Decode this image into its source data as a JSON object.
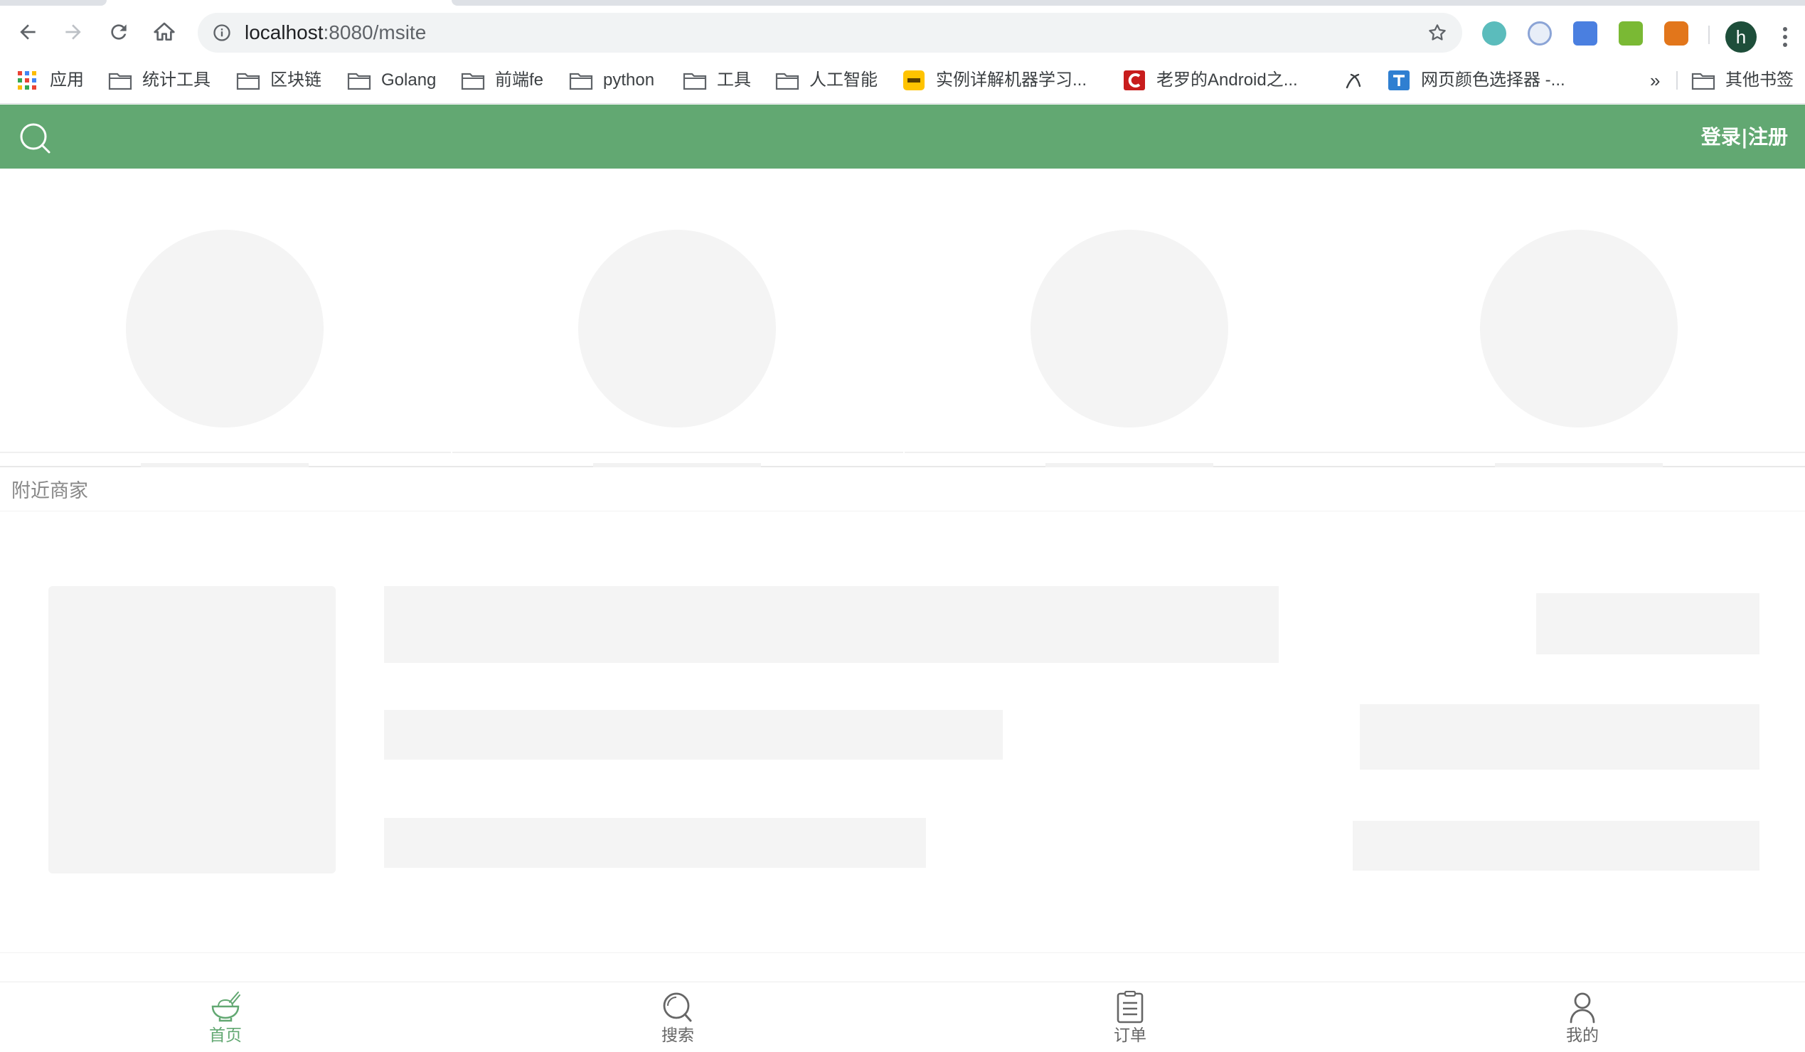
{
  "browser": {
    "url_host": "localhost",
    "url_path": ":8080/msite",
    "profile_initial": "h",
    "bookmarks": [
      {
        "label": "应用",
        "icon": "apps-grid-icon"
      },
      {
        "label": "统计工具",
        "icon": "folder-icon"
      },
      {
        "label": "区块链",
        "icon": "folder-icon"
      },
      {
        "label": "Golang",
        "icon": "folder-icon"
      },
      {
        "label": "前端fe",
        "icon": "folder-icon"
      },
      {
        "label": "python",
        "icon": "folder-icon"
      },
      {
        "label": "工具",
        "icon": "folder-icon"
      },
      {
        "label": "人工智能",
        "icon": "folder-icon"
      },
      {
        "label": "实例详解机器学习...",
        "icon": "meituan-favicon"
      },
      {
        "label": "老罗的Android之...",
        "icon": "csdn-favicon"
      },
      {
        "label": "",
        "icon": "custom-favicon"
      },
      {
        "label": "网页颜色选择器 -...",
        "icon": "site-favicon"
      }
    ],
    "more_bookmarks": "»",
    "other_bookmarks": "其他书签"
  },
  "app": {
    "header": {
      "login_text": "登录|注册",
      "bg_color": "#62a872"
    },
    "section_title": "附近商家",
    "tabs": [
      {
        "label": "首页",
        "icon": "home-bowl-icon",
        "active": true
      },
      {
        "label": "搜索",
        "icon": "search-icon",
        "active": false
      },
      {
        "label": "订单",
        "icon": "order-list-icon",
        "active": false
      },
      {
        "label": "我的",
        "icon": "profile-icon",
        "active": false
      }
    ]
  },
  "colors": {
    "accent": "#62a872",
    "skeleton": "#f4f4f4"
  }
}
